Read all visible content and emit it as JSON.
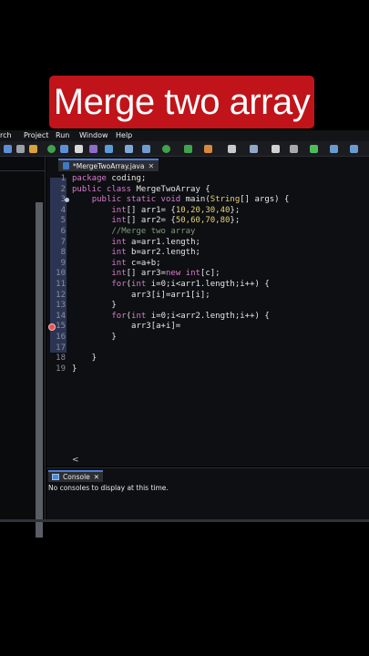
{
  "banner": {
    "title": "Merge two array"
  },
  "menubar": {
    "items": [
      "rch",
      "Project",
      "Run",
      "Window",
      "Help"
    ]
  },
  "editor": {
    "tab_label": "*MergeTwoArray.java",
    "tab_close": "✕",
    "lines": [
      {
        "n": "1",
        "tokens": [
          [
            "kw",
            "package "
          ],
          [
            "plain",
            "coding;"
          ]
        ]
      },
      {
        "n": "2",
        "tokens": [
          [
            "kw",
            "public class "
          ],
          [
            "plain",
            "MergeTwoArray {"
          ]
        ]
      },
      {
        "n": "3",
        "tokens": [
          [
            "plain",
            "    "
          ],
          [
            "kw",
            "public static void "
          ],
          [
            "plain",
            "main("
          ],
          [
            "ty",
            "String"
          ],
          [
            "plain",
            "[] args) {"
          ]
        ]
      },
      {
        "n": "4",
        "tokens": [
          [
            "plain",
            "        "
          ],
          [
            "kw",
            "int"
          ],
          [
            "plain",
            "[] arr1= {"
          ],
          [
            "num",
            "10,20,30,40"
          ],
          [
            "plain",
            "};"
          ]
        ]
      },
      {
        "n": "5",
        "tokens": [
          [
            "plain",
            "        "
          ],
          [
            "kw",
            "int"
          ],
          [
            "plain",
            "[] arr2= {"
          ],
          [
            "num",
            "50,60,70,80"
          ],
          [
            "plain",
            "};"
          ]
        ]
      },
      {
        "n": "6",
        "tokens": [
          [
            "plain",
            "        "
          ],
          [
            "cm",
            "//Merge two array"
          ]
        ]
      },
      {
        "n": "7",
        "tokens": [
          [
            "plain",
            "        "
          ],
          [
            "kw",
            "int "
          ],
          [
            "plain",
            "a=arr1.length;"
          ]
        ]
      },
      {
        "n": "8",
        "tokens": [
          [
            "plain",
            "        "
          ],
          [
            "kw",
            "int "
          ],
          [
            "plain",
            "b=arr2.length;"
          ]
        ]
      },
      {
        "n": "9",
        "tokens": [
          [
            "plain",
            "        "
          ],
          [
            "kw",
            "int "
          ],
          [
            "plain",
            "c=a+b;"
          ]
        ]
      },
      {
        "n": "10",
        "tokens": [
          [
            "plain",
            "        "
          ],
          [
            "kw",
            "int"
          ],
          [
            "plain",
            "[] arr3="
          ],
          [
            "kw",
            "new int"
          ],
          [
            "plain",
            "[c];"
          ]
        ]
      },
      {
        "n": "11",
        "tokens": [
          [
            "plain",
            "        "
          ],
          [
            "kw",
            "for"
          ],
          [
            "plain",
            "("
          ],
          [
            "kw",
            "int "
          ],
          [
            "plain",
            "i=0;i<arr1.length;i++) {"
          ]
        ]
      },
      {
        "n": "12",
        "tokens": [
          [
            "plain",
            "            arr3[i]=arr1[i];"
          ]
        ]
      },
      {
        "n": "13",
        "tokens": [
          [
            "plain",
            "        }"
          ]
        ]
      },
      {
        "n": "14",
        "tokens": [
          [
            "plain",
            "        "
          ],
          [
            "kw",
            "for"
          ],
          [
            "plain",
            "("
          ],
          [
            "kw",
            "int "
          ],
          [
            "plain",
            "i=0;i<arr2.length;i++) {"
          ]
        ]
      },
      {
        "n": "15",
        "tokens": [
          [
            "plain",
            "            arr3[a+i]="
          ]
        ]
      },
      {
        "n": "16",
        "tokens": [
          [
            "plain",
            "        }"
          ]
        ]
      },
      {
        "n": "17",
        "tokens": [
          [
            "plain",
            ""
          ]
        ]
      },
      {
        "n": "18",
        "tokens": [
          [
            "plain",
            "    }"
          ]
        ]
      },
      {
        "n": "19",
        "tokens": [
          [
            "plain",
            "}"
          ]
        ]
      }
    ],
    "scroll_left_glyph": "<"
  },
  "console": {
    "tab_label": "Console",
    "tab_close": "✕",
    "message": "No consoles to display at this time."
  },
  "colors": {
    "banner_bg": "#c0141a",
    "keyword": "#d77bd0",
    "type": "#e6d27a",
    "comment": "#7f9a7a",
    "accent": "#4b7bd6"
  }
}
